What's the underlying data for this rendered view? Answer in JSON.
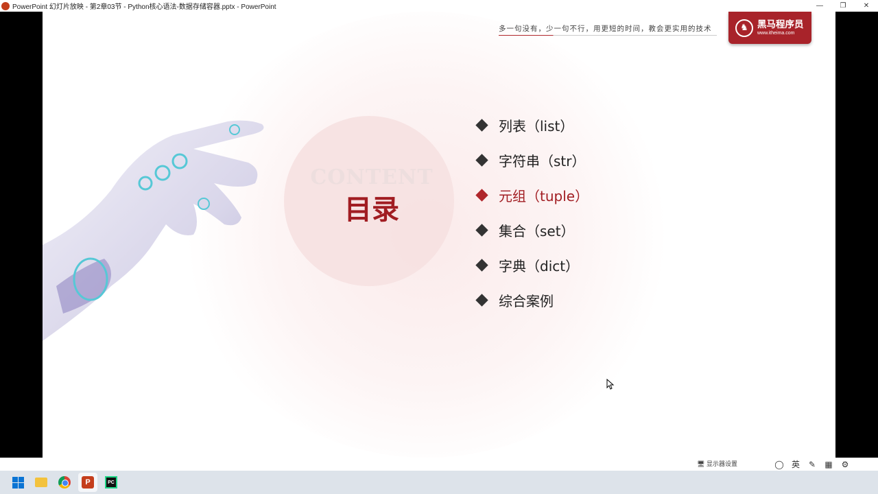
{
  "window": {
    "title": "PowerPoint 幻灯片放映  -  第2章03节 - Python核心语法-数据存储容器.pptx - PowerPoint",
    "minimize": "—",
    "restore": "❐",
    "close": "✕"
  },
  "slide": {
    "motto": "多一句没有，少一句不行，用更短的时间，教会更实用的技术",
    "logo_name": "黑马程序员",
    "logo_url": "www.itheima.com",
    "watermark": "CONTENT",
    "title": "目录",
    "toc": [
      {
        "label": "列表（list）",
        "active": false
      },
      {
        "label": "字符串（str）",
        "active": false
      },
      {
        "label": "元组（tuple）",
        "active": true
      },
      {
        "label": "集合（set）",
        "active": false
      },
      {
        "label": "字典（dict）",
        "active": false
      },
      {
        "label": "综合案例",
        "active": false
      }
    ],
    "accent_color": "#a11d22"
  },
  "presentation_bar": {
    "status": "显示器设置"
  },
  "taskbar": {
    "icons": [
      "windows-start-icon",
      "file-explorer-icon",
      "chrome-icon",
      "powerpoint-icon",
      "pycharm-icon"
    ]
  }
}
